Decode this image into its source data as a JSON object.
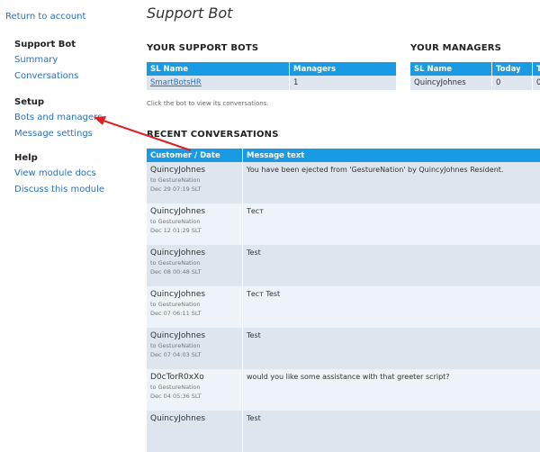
{
  "sidebar": {
    "back_link": "Return to account",
    "groups": [
      {
        "heading": "Support Bot",
        "links": [
          "Summary",
          "Conversations"
        ]
      },
      {
        "heading": "Setup",
        "links": [
          "Bots and managers",
          "Message settings"
        ]
      },
      {
        "heading": "Help",
        "links": [
          "View module docs",
          "Discuss this module"
        ]
      }
    ]
  },
  "main": {
    "title": "Support Bot",
    "bots": {
      "title": "YOUR SUPPORT BOTS",
      "columns": [
        "SL Name",
        "Managers"
      ],
      "rows": [
        {
          "name": "SmartBotsHR",
          "managers": "1"
        }
      ],
      "hint": "Click the bot to view its conversations."
    },
    "managers": {
      "title": "YOUR MANAGERS",
      "columns": [
        "SL Name",
        "Today",
        "T"
      ],
      "rows": [
        {
          "name": "QuincyJohnes",
          "today": "0",
          "t": "0"
        }
      ]
    },
    "recent": {
      "title": "RECENT CONVERSATIONS",
      "columns": [
        "Customer / Date",
        "Message text"
      ],
      "rows": [
        {
          "customer": "QuincyJohnes",
          "to": "to GestureNation",
          "date": "Dec 29 07:19 SLT",
          "message": "You have been ejected from 'GestureNation' by QuincyJohnes Resident."
        },
        {
          "customer": "QuincyJohnes",
          "to": "to GestureNation",
          "date": "Dec 12 01:29 SLT",
          "message": "Тест"
        },
        {
          "customer": "QuincyJohnes",
          "to": "to GestureNation",
          "date": "Dec 08 00:48 SLT",
          "message": "Test"
        },
        {
          "customer": "QuincyJohnes",
          "to": "to GestureNation",
          "date": "Dec 07 06:11 SLT",
          "message": "Тест Test"
        },
        {
          "customer": "QuincyJohnes",
          "to": "to GestureNation",
          "date": "Dec 07 04:03 SLT",
          "message": "Test"
        },
        {
          "customer": "D0cTorR0xXo",
          "to": "to GestureNation",
          "date": "Dec 04 05:36 SLT",
          "message": "would you like some assistance with that greeter script?"
        },
        {
          "customer": "QuincyJohnes",
          "to": "",
          "date": "",
          "message": "Test"
        }
      ]
    }
  },
  "colors": {
    "header_bg": "#1b9ae4",
    "link": "#2b6fb8",
    "row_odd": "#dde6ee",
    "row_even": "#edf3f8",
    "arrow": "#e02020"
  }
}
